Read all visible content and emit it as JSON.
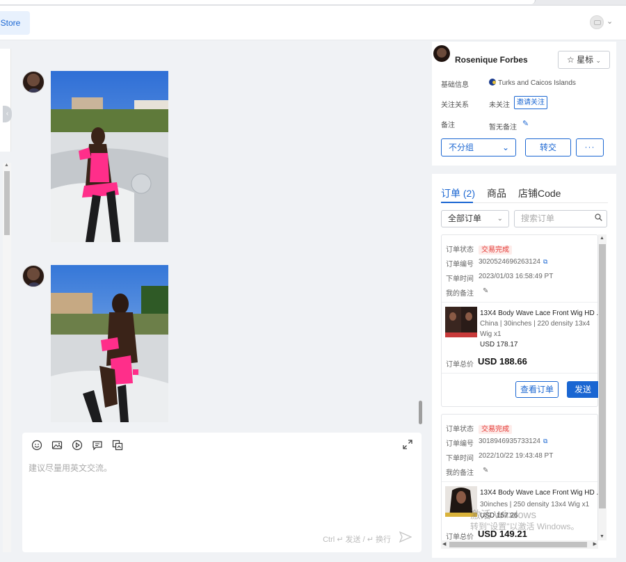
{
  "header": {
    "store_tab_label": "al Store"
  },
  "left_panel": {
    "collapse_glyph": "‹"
  },
  "chat": {
    "messages": [
      {
        "type": "image",
        "description_icon": "photo-icon"
      },
      {
        "type": "image",
        "description_icon": "photo-icon"
      }
    ]
  },
  "composer": {
    "placeholder": "建议尽量用英文交流。",
    "send_hint": "Ctrl ↵ 发送 / ↵ 换行",
    "toolbar_icons": [
      "emoji-icon",
      "image-icon",
      "video-icon",
      "quick-reply-icon",
      "product-card-icon"
    ]
  },
  "customer": {
    "name": "Rosenique Forbes",
    "star_label": "星标",
    "info": {
      "basic_label": "基础信息",
      "country": "Turks and Caicos Islands",
      "follow_label": "关注关系",
      "follow_status": "未关注",
      "invite_label": "邀请关注",
      "note_label": "备注",
      "note_value": "暂无备注"
    },
    "group_select": "不分组",
    "transfer_label": "转交",
    "more_label": "···"
  },
  "orders": {
    "tabs": [
      {
        "label": "订单 (2)",
        "active": true
      },
      {
        "label": "商品",
        "active": false
      },
      {
        "label": "店铺Code",
        "active": false
      }
    ],
    "filter": "全部订单",
    "search_placeholder": "搜索订单",
    "labels": {
      "status": "订单状态",
      "number": "订单编号",
      "time": "下单时间",
      "my_note": "我的备注",
      "total": "订单总价",
      "view": "查看订单",
      "send": "发送"
    },
    "items": [
      {
        "status": "交易完成",
        "number": "3020524696263124",
        "time": "2023/01/03 16:58:49 PT",
        "product_title": "13X4 Body Wave Lace Front Wig HD ...",
        "product_spec": "China | 30inches | 220 density 13x4 Wig x1",
        "product_price": "USD 178.17",
        "total": "USD 188.66"
      },
      {
        "status": "交易完成",
        "number": "3018946935733124",
        "time": "2022/10/22 19:43:48 PT",
        "product_title": "13X4 Body Wave Lace Front Wig HD ...",
        "product_spec": "30inches | 250 density 13x4 Wig x1",
        "product_price": "USD 157.26",
        "total": "USD 149.21"
      }
    ]
  },
  "watermark": {
    "line1": "激活 Windows",
    "line2": "转到\"设置\"以激活 Windows。"
  },
  "colors": {
    "accent": "#1a66d2",
    "status_red": "#e53935",
    "status_bg": "#fdecea",
    "page_bg": "#f0f2f5"
  }
}
